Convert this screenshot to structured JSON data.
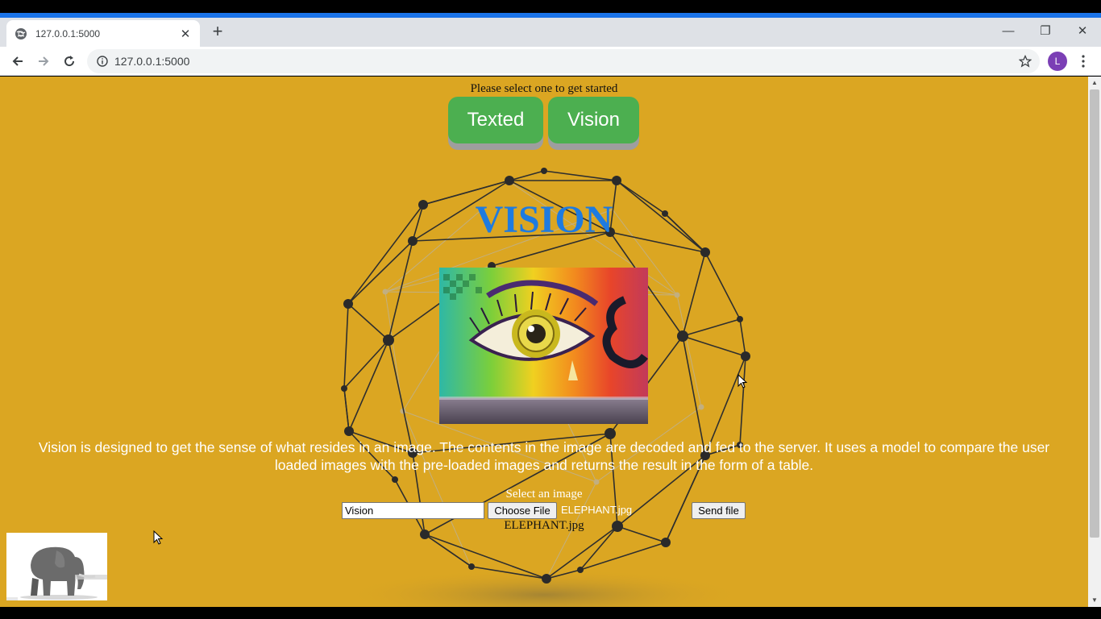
{
  "browser": {
    "tab_title": "127.0.0.1:5000",
    "tab_close": "✕",
    "new_tab": "+",
    "url": "127.0.0.1:5000",
    "profile_initial": "L",
    "window_controls": {
      "minimize": "—",
      "restore": "❐",
      "close": "✕"
    }
  },
  "page": {
    "prompt": "Please select one to get started",
    "buttons": {
      "texted": "Texted",
      "vision": "Vision"
    },
    "title": "VISION",
    "description": "Vision is designed to get the sense of what resides in an image. The contents in the image are decoded and fed to the server. It uses a model to compare the user loaded images with the pre-loaded images and returns the result in the form of a table.",
    "upload": {
      "label": "Select an image",
      "text_value": "Vision",
      "choose_label": "Choose File",
      "file_name": "ELEPHANT.jpg",
      "send_label": "Send file",
      "caption": "ELEPHANT.jpg"
    }
  },
  "colors": {
    "page_background": "#dba622",
    "title_blue": "#1e7be0",
    "button_green": "#4caf50",
    "chrome_blue": "#1a73e8"
  },
  "icons": [
    "globe-icon",
    "back-icon",
    "forward-icon",
    "reload-icon",
    "info-icon",
    "star-icon",
    "kebab-menu-icon"
  ]
}
